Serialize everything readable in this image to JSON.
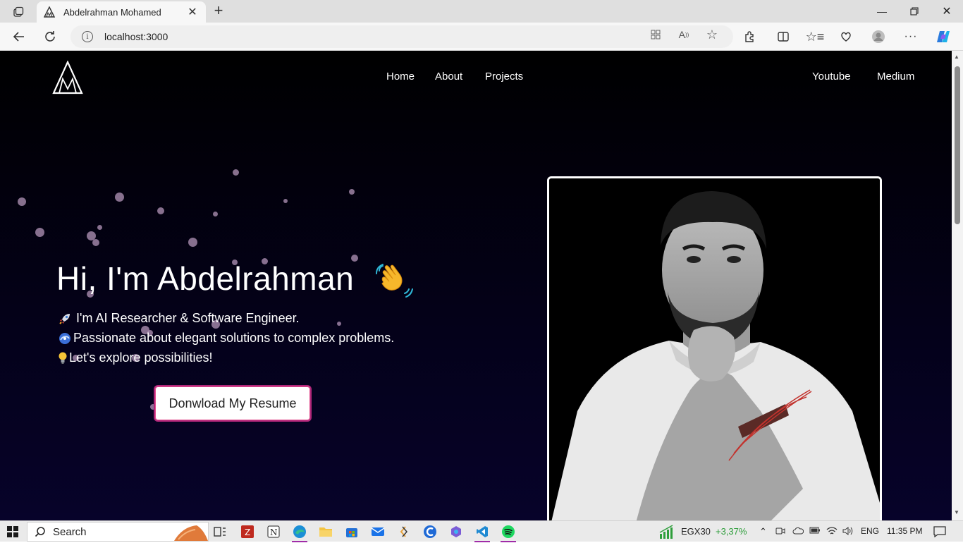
{
  "browser": {
    "tab_title": "Abdelrahman Mohamed",
    "url": "localhost:3000"
  },
  "site": {
    "nav_links": [
      "Home",
      "About",
      "Projects"
    ],
    "nav_external": [
      "Youtube",
      "Medium"
    ],
    "hero": {
      "title": "Hi, I'm Abdelrahman",
      "lines": [
        "I'm AI Researcher & Software Engineer.",
        "Passionate about elegant solutions to complex problems.",
        "Let's explore possibilities!"
      ],
      "resume_button": "Donwload My Resume"
    },
    "colors": {
      "background": "#000000",
      "button_border": "#b0277a"
    }
  },
  "taskbar": {
    "search_label": "Search",
    "stock_name": "EGX30",
    "stock_change": "+3,37%",
    "language": "ENG",
    "time": "11:35 PM"
  }
}
